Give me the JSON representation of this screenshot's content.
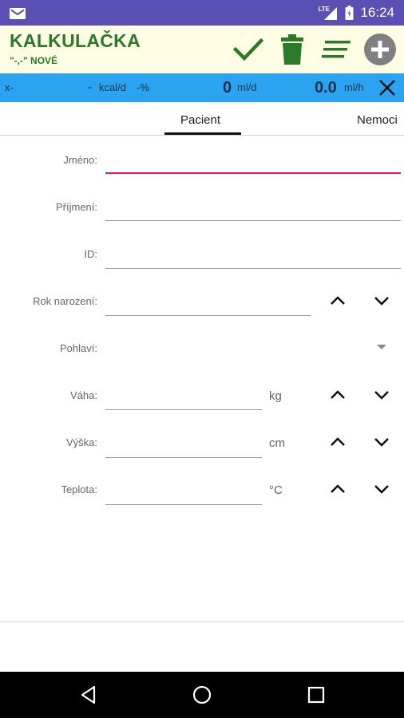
{
  "status_bar": {
    "network_label": "LTE",
    "time": "16:24",
    "icons": [
      "mail-icon",
      "signal-icon",
      "battery-icon"
    ]
  },
  "app_bar": {
    "title": "KALKULAČKA",
    "subtitle": "\"-,-\" NOVÉ",
    "actions": [
      "check-icon",
      "trash-icon",
      "sort-icon",
      "add-circle-icon"
    ],
    "accent_color": "#2a7a2a",
    "background_color": "#fffde3"
  },
  "info_bar": {
    "x_label": "x-",
    "kcal_value": "-",
    "kcal_unit": "kcal/d",
    "percent": "-%",
    "volume_value": "0",
    "volume_unit": "ml/d",
    "rate_value": "0.0",
    "rate_unit": "ml/h",
    "background_color": "#2aa3f0"
  },
  "tabs": [
    {
      "label": "Pacient",
      "active": true
    },
    {
      "label": "Nemoci",
      "active": false
    }
  ],
  "form": {
    "name_label": "Jméno:",
    "name_value": "",
    "surname_label": "Příjmení:",
    "surname_value": "",
    "id_label": "ID:",
    "id_value": "",
    "birth_year_label": "Rok narození:",
    "birth_year_value": "",
    "gender_label": "Pohlaví:",
    "gender_value": "",
    "weight_label": "Váha:",
    "weight_value": "",
    "weight_unit": "kg",
    "height_label": "Výška:",
    "height_value": "",
    "height_unit": "cm",
    "temperature_label": "Teplota:",
    "temperature_value": "",
    "temperature_unit": "°C",
    "focus_color": "#e2127a"
  },
  "nav_bar": {
    "buttons": [
      "back-icon",
      "home-icon",
      "recents-icon"
    ]
  }
}
